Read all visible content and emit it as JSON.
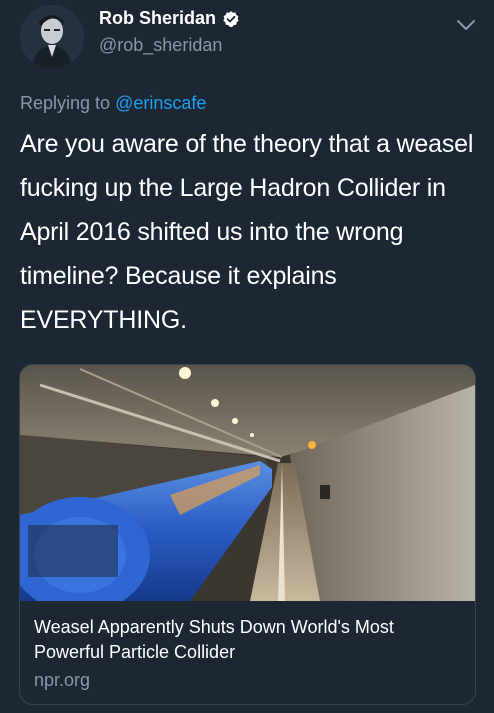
{
  "author": {
    "name": "Rob Sheridan",
    "handle": "@rob_sheridan",
    "verified": true,
    "avatar_icon": "avatar-photo"
  },
  "reply": {
    "prefix": "Replying to ",
    "mention": "@erinscafe"
  },
  "tweet": {
    "text": "Are you aware of the theory that a weasel fucking up the Large Hadron Collider in April 2016 shifted us into the wrong timeline? Because it explains EVERYTHING."
  },
  "card": {
    "title": "Weasel Apparently Shuts Down World's Most Powerful Particle Collider",
    "domain": "npr.org",
    "image_icon": "particle-collider-tunnel-photo"
  },
  "colors": {
    "background": "#1c2733",
    "text": "#ffffff",
    "secondary": "#8899a6",
    "link": "#1da1f2",
    "border": "#38444d"
  }
}
